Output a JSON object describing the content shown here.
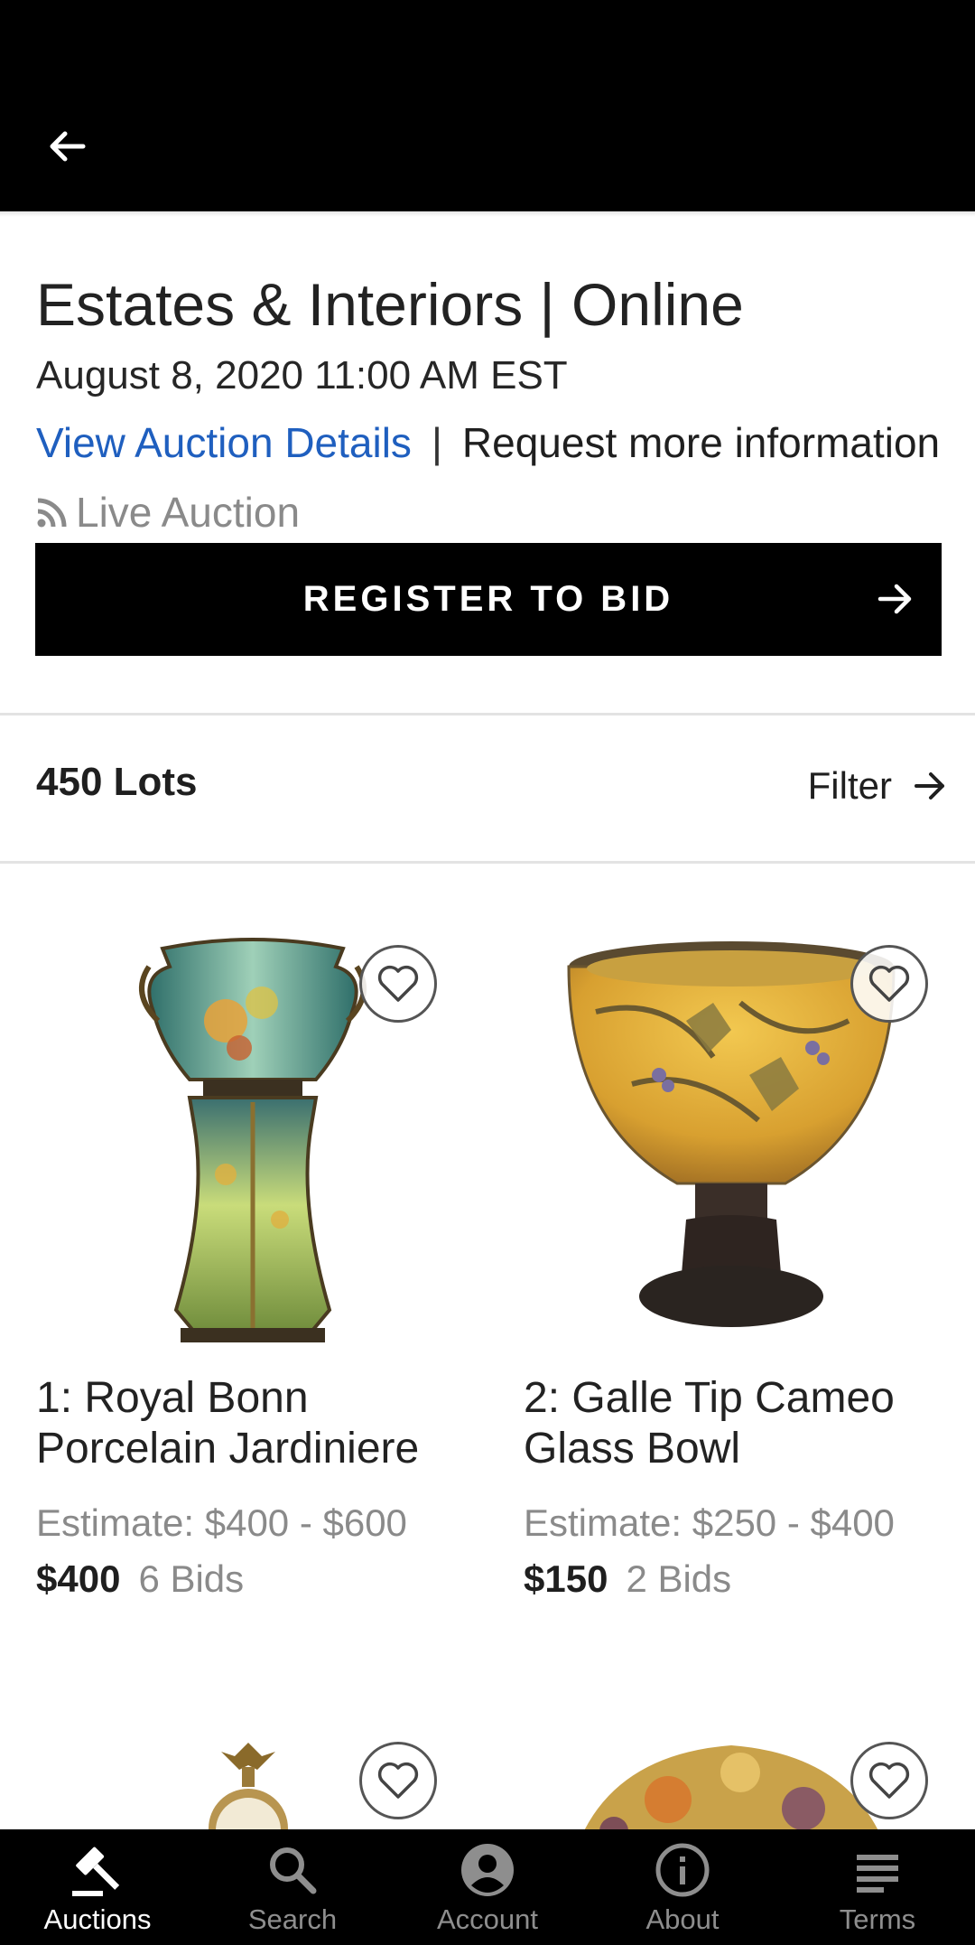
{
  "header": {
    "back_icon": "arrow-left-icon"
  },
  "auction": {
    "title": "Estates & Interiors | Online",
    "date": "August 8, 2020 11:00 AM EST",
    "details_link": "View Auction Details",
    "separator": "|",
    "info_link": "Request more information",
    "live_label": "Live Auction",
    "live_icon": "rss-feed-icon",
    "register_label": "REGISTER TO BID",
    "link_color": "#1f5fbf"
  },
  "lots_header": {
    "count": "450 Lots",
    "filter_label": "Filter"
  },
  "lots": [
    {
      "title": "1: Royal Bonn Porcelain Jardiniere",
      "estimate": "Estimate: $400 - $600",
      "price": "$400",
      "bids": "6 Bids",
      "favorite_icon": "heart-outline-icon"
    },
    {
      "title": "2: Galle Tip Cameo Glass Bowl",
      "estimate": "Estimate: $250 - $400",
      "price": "$150",
      "bids": "2 Bids",
      "favorite_icon": "heart-outline-icon"
    },
    {
      "favorite_icon": "heart-outline-icon"
    },
    {
      "favorite_icon": "heart-outline-icon"
    }
  ],
  "bottom_nav": [
    {
      "label": "Auctions",
      "icon": "gavel-icon",
      "active": true
    },
    {
      "label": "Search",
      "icon": "search-icon",
      "active": false
    },
    {
      "label": "Account",
      "icon": "account-circle-icon",
      "active": false
    },
    {
      "label": "About",
      "icon": "info-icon",
      "active": false
    },
    {
      "label": "Terms",
      "icon": "notes-icon",
      "active": false
    }
  ]
}
